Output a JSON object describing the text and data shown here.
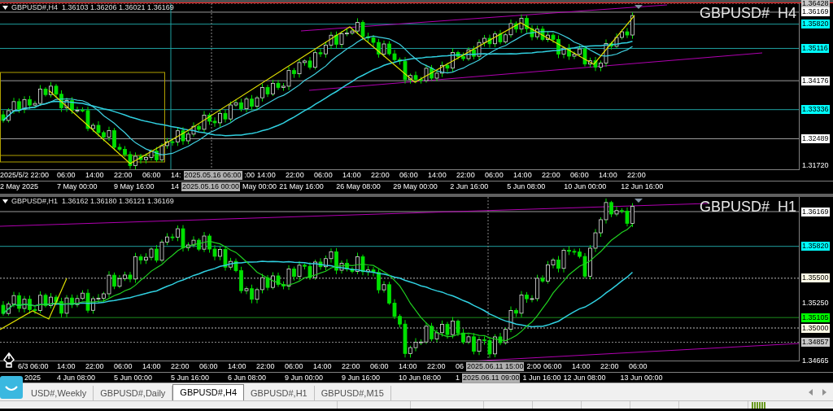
{
  "panes": [
    {
      "header": "GBPUSD#,H4  1.36103 1.36206 1.36021 1.36169",
      "title": "GBPUSD#  H4",
      "price_labels": [
        {
          "text": "1.36428",
          "kind": "grey"
        },
        {
          "text": "1.36169",
          "kind": "white"
        },
        {
          "text": "1.35820",
          "kind": "cyan"
        },
        {
          "text": "1.35116",
          "kind": "cyan"
        },
        {
          "text": "1.34176",
          "kind": "white"
        },
        {
          "text": "1.33336",
          "kind": "cyan"
        },
        {
          "text": "1.32489",
          "kind": "white"
        },
        {
          "text": "1.31720",
          "kind": "plain"
        }
      ],
      "time_rows": [
        [
          {
            "text": "2025/5/2 22:00",
            "kind": "start"
          },
          {
            "text": "06:00",
            "kind": "tick"
          },
          {
            "text": "14:00",
            "kind": "tick"
          },
          {
            "text": "22:00",
            "kind": "tick"
          },
          {
            "text": "06:00",
            "kind": "tick"
          },
          {
            "text": "14:",
            "kind": "cut"
          },
          {
            "text": "2025.05.16 06:00",
            "kind": "highlight"
          },
          {
            "text": ":00",
            "kind": "cut"
          },
          {
            "text": "14:00",
            "kind": "tick"
          },
          {
            "text": "22:00",
            "kind": "tick"
          },
          {
            "text": "06:00",
            "kind": "tick"
          },
          {
            "text": "14:00",
            "kind": "tick"
          },
          {
            "text": "22:00",
            "kind": "tick"
          },
          {
            "text": "06:00",
            "kind": "tick"
          },
          {
            "text": "14:00",
            "kind": "tick"
          },
          {
            "text": "22:00",
            "kind": "tick"
          },
          {
            "text": "06:00",
            "kind": "tick"
          },
          {
            "text": "14:00",
            "kind": "tick"
          },
          {
            "text": "22:00",
            "kind": "tick"
          },
          {
            "text": "06:00",
            "kind": "tick"
          },
          {
            "text": "14:00",
            "kind": "tick"
          },
          {
            "text": "22:00",
            "kind": "tick"
          }
        ],
        [
          {
            "text": "2 May 2025",
            "kind": "start"
          },
          {
            "text": "7 May 00:00",
            "kind": "tick"
          },
          {
            "text": "9 May 16:00",
            "kind": "tick"
          },
          {
            "text": "14",
            "kind": "cut"
          },
          {
            "text": "2025.05.16 00:00",
            "kind": "highlight"
          },
          {
            "text": "May 00:00",
            "kind": "cut"
          },
          {
            "text": "21 May 16:00",
            "kind": "tick"
          },
          {
            "text": "26 May 08:00",
            "kind": "tick"
          },
          {
            "text": "29 May 00:00",
            "kind": "tick"
          },
          {
            "text": "2 Jun 16:00",
            "kind": "tick"
          },
          {
            "text": "5 Jun 08:00",
            "kind": "tick"
          },
          {
            "text": "10 Jun 00:00",
            "kind": "tick"
          },
          {
            "text": "12 Jun 16:00",
            "kind": "tick"
          }
        ]
      ]
    },
    {
      "header": "GBPUSD#,H1  1.36162 1.36180 1.36121 1.36169",
      "title": "GBPUSD#  H1",
      "price_labels": [
        {
          "text": "1.36169",
          "kind": "white"
        },
        {
          "text": "1.35820",
          "kind": "cyan"
        },
        {
          "text": "1.35500",
          "kind": "cream"
        },
        {
          "text": "1.35250",
          "kind": "plain"
        },
        {
          "text": "1.35105",
          "kind": "green"
        },
        {
          "text": "1.35000",
          "kind": "cream"
        },
        {
          "text": "1.34857",
          "kind": "grey"
        },
        {
          "text": "1.34665",
          "kind": "plain"
        }
      ],
      "time_rows": [
        [
          {
            "text": "6/3 06:00",
            "kind": "start"
          },
          {
            "text": "14:00",
            "kind": "tick"
          },
          {
            "text": "22:00",
            "kind": "tick"
          },
          {
            "text": "06:00",
            "kind": "tick"
          },
          {
            "text": "14:00",
            "kind": "tick"
          },
          {
            "text": "22:00",
            "kind": "tick"
          },
          {
            "text": "06:00",
            "kind": "tick"
          },
          {
            "text": "14:00",
            "kind": "tick"
          },
          {
            "text": "22:00",
            "kind": "tick"
          },
          {
            "text": "06:00",
            "kind": "tick"
          },
          {
            "text": "14:00",
            "kind": "tick"
          },
          {
            "text": "22:00",
            "kind": "tick"
          },
          {
            "text": "06:00",
            "kind": "tick"
          },
          {
            "text": "14:00",
            "kind": "tick"
          },
          {
            "text": "22:00",
            "kind": "tick"
          },
          {
            "text": "06",
            "kind": "cut"
          },
          {
            "text": "2025.06.11 15:00",
            "kind": "highlight"
          },
          {
            "text": "2:00",
            "kind": "cut"
          },
          {
            "text": "06:00",
            "kind": "tick"
          },
          {
            "text": "14:00",
            "kind": "tick"
          },
          {
            "text": "22:00",
            "kind": "tick"
          },
          {
            "text": "06:00",
            "kind": "tick"
          }
        ],
        [
          {
            "text": "2025",
            "kind": "start"
          },
          {
            "text": "4 Jun 08:00",
            "kind": "tick"
          },
          {
            "text": "5 Jun 00:00",
            "kind": "tick"
          },
          {
            "text": "5 Jun 16:00",
            "kind": "tick"
          },
          {
            "text": "6 Jun 08:00",
            "kind": "tick"
          },
          {
            "text": "9 Jun 00:00",
            "kind": "tick"
          },
          {
            "text": "9 Jun 16:00",
            "kind": "tick"
          },
          {
            "text": "10 Jun 08:00",
            "kind": "tick"
          },
          {
            "text": "1",
            "kind": "cut"
          },
          {
            "text": "2025.06.11 09:00",
            "kind": "highlight"
          },
          {
            "text": "1 Jun 16:00",
            "kind": "cut"
          },
          {
            "text": "12 Jun 08:00",
            "kind": "tick"
          },
          {
            "text": "13 Jun 00:00",
            "kind": "tick"
          }
        ]
      ]
    }
  ],
  "tabs": [
    {
      "label": "USD#,Weekly",
      "selected": false
    },
    {
      "label": "GBPUSD#,Daily",
      "selected": false
    },
    {
      "label": "GBPUSD#,H4",
      "selected": true
    },
    {
      "label": "GBPUSD#,H1",
      "selected": false
    },
    {
      "label": "GBPUSD#,M15",
      "selected": false
    }
  ]
}
